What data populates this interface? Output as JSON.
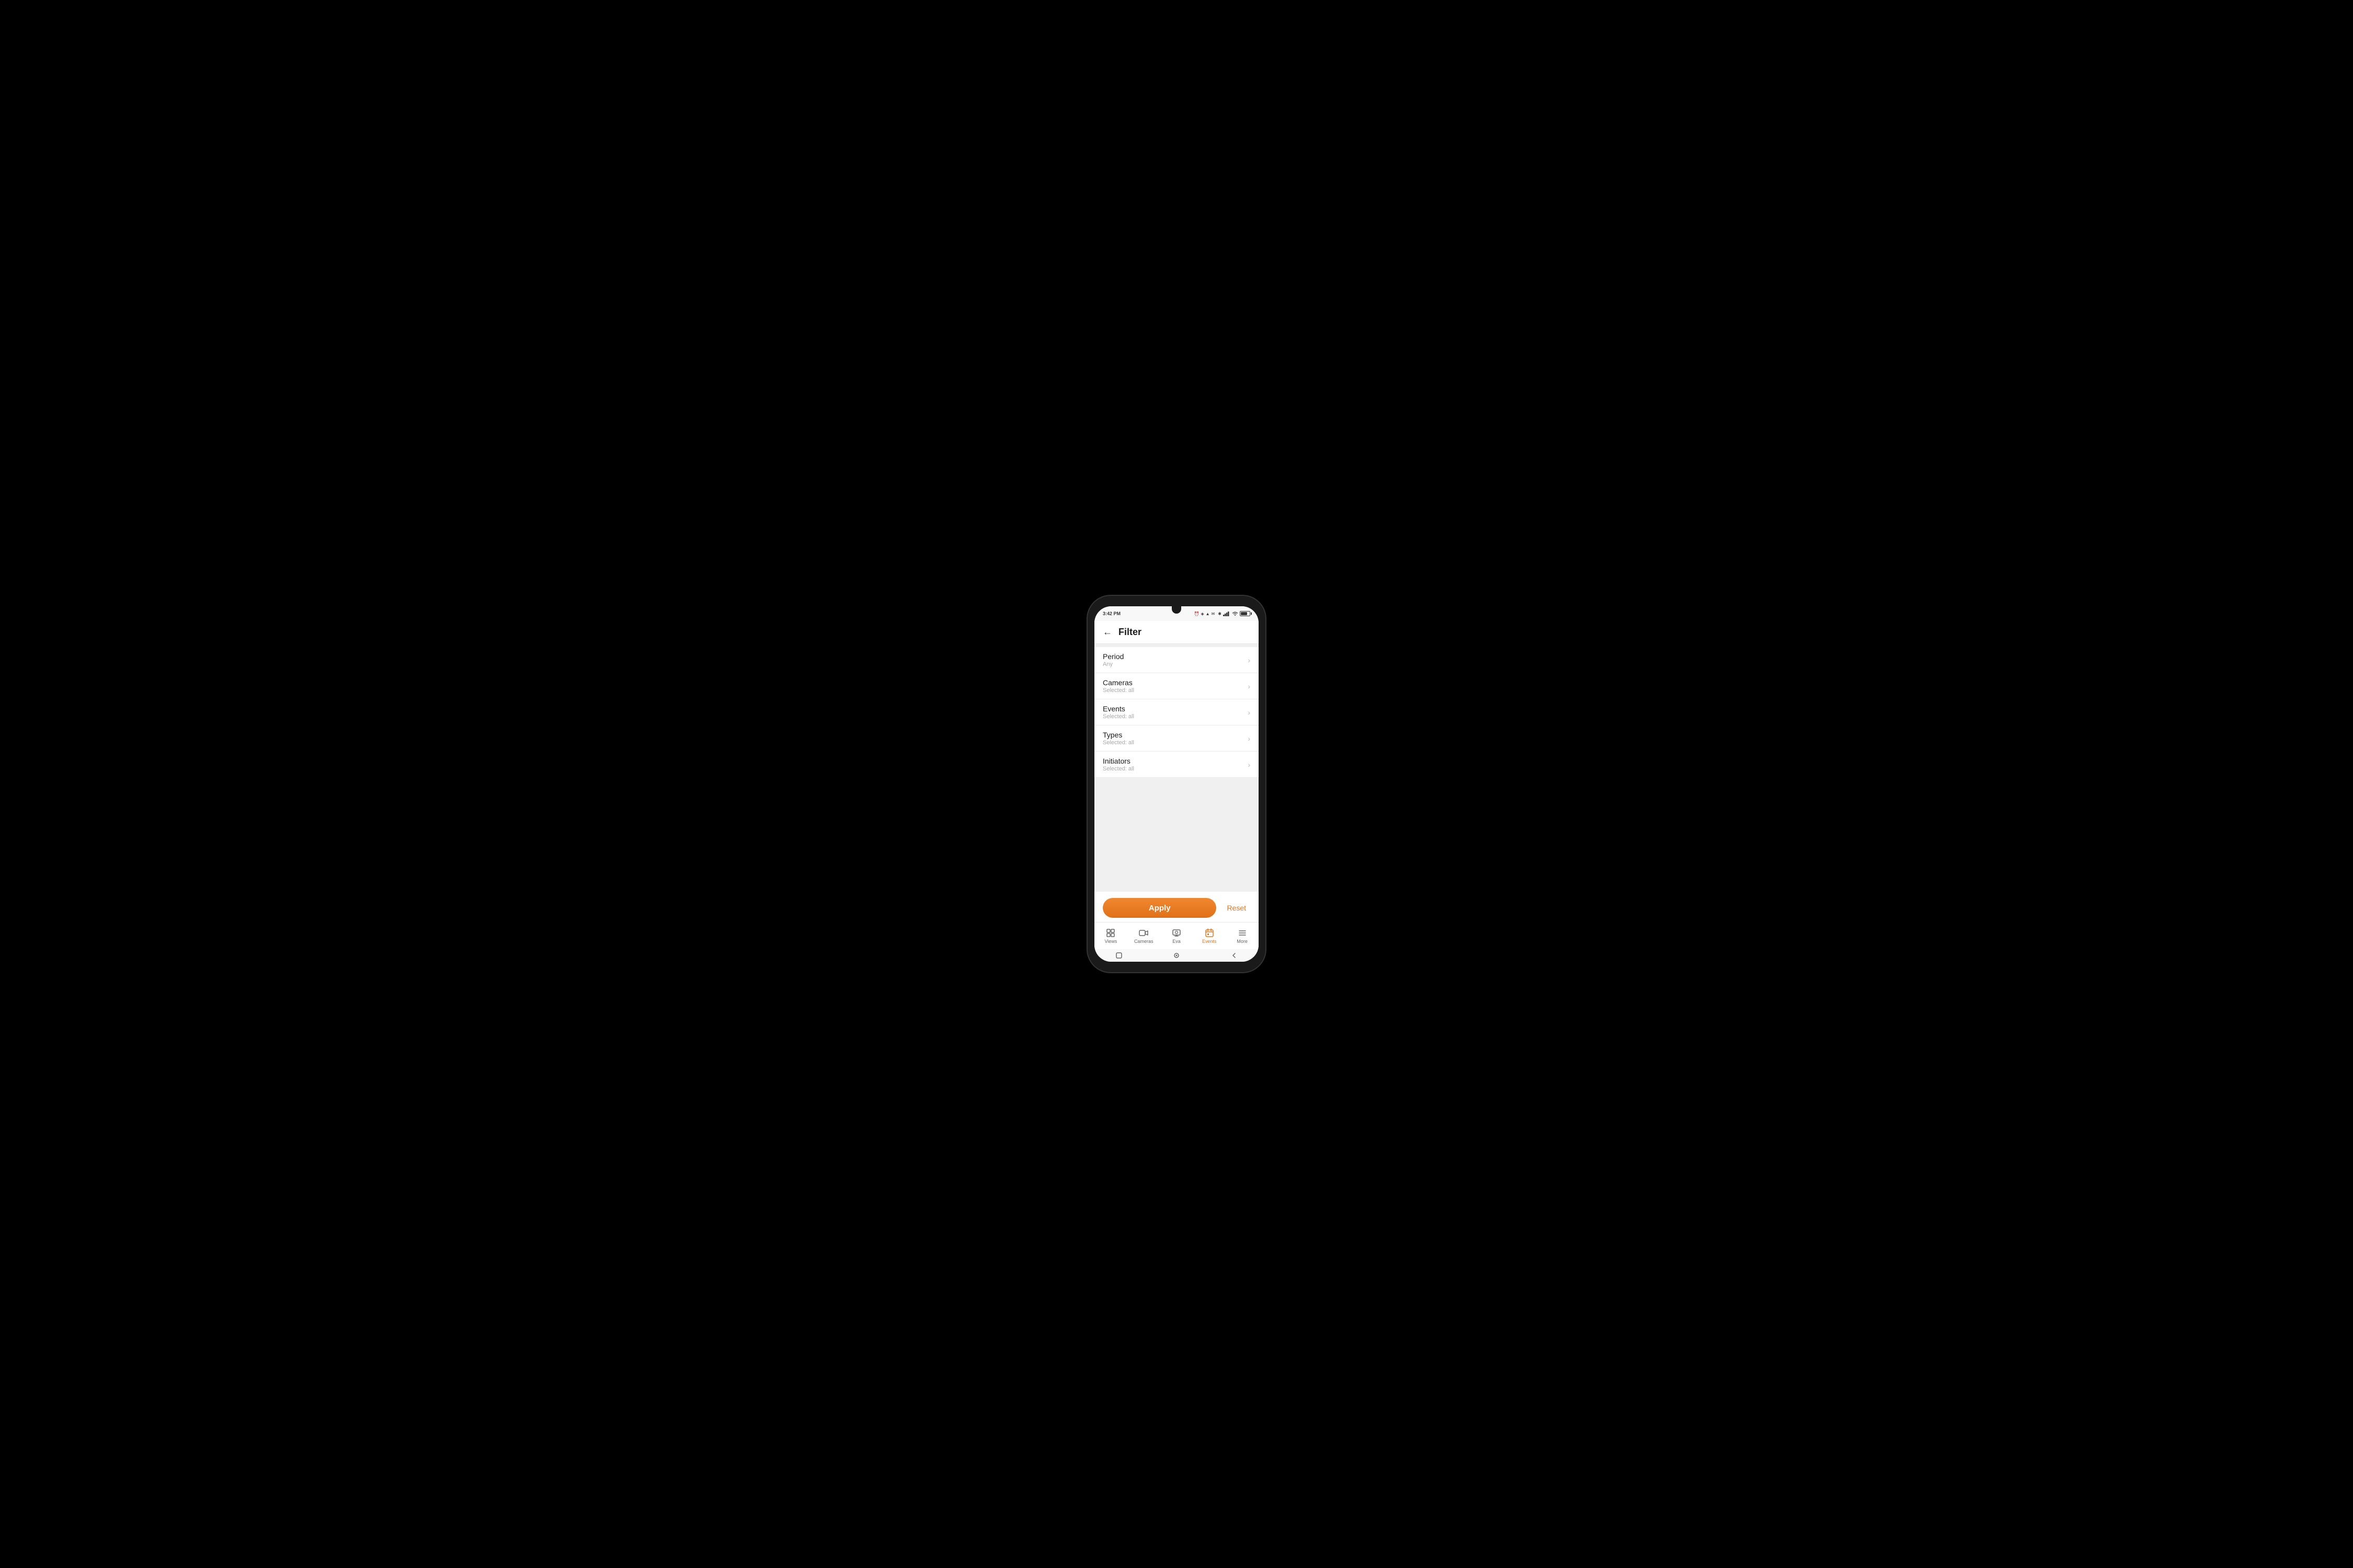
{
  "status_bar": {
    "time": "3:42 PM",
    "battery_percent": "64"
  },
  "header": {
    "back_label": "←",
    "title": "Filter"
  },
  "filter_items": [
    {
      "id": "period",
      "label": "Period",
      "value": "Any"
    },
    {
      "id": "cameras",
      "label": "Cameras",
      "value": "Selected: all"
    },
    {
      "id": "events",
      "label": "Events",
      "value": "Selected: all"
    },
    {
      "id": "types",
      "label": "Types",
      "value": "Selected: all"
    },
    {
      "id": "initiators",
      "label": "Initiators",
      "value": "Selected: all"
    }
  ],
  "actions": {
    "apply_label": "Apply",
    "reset_label": "Reset"
  },
  "bottom_nav": {
    "items": [
      {
        "id": "views",
        "label": "Views",
        "active": false
      },
      {
        "id": "cameras",
        "label": "Cameras",
        "active": false
      },
      {
        "id": "eva",
        "label": "Eva",
        "active": false
      },
      {
        "id": "events",
        "label": "Events",
        "active": true
      },
      {
        "id": "more",
        "label": "More",
        "active": false
      }
    ]
  },
  "colors": {
    "accent": "#e07820",
    "accent_text": "#e07820"
  }
}
